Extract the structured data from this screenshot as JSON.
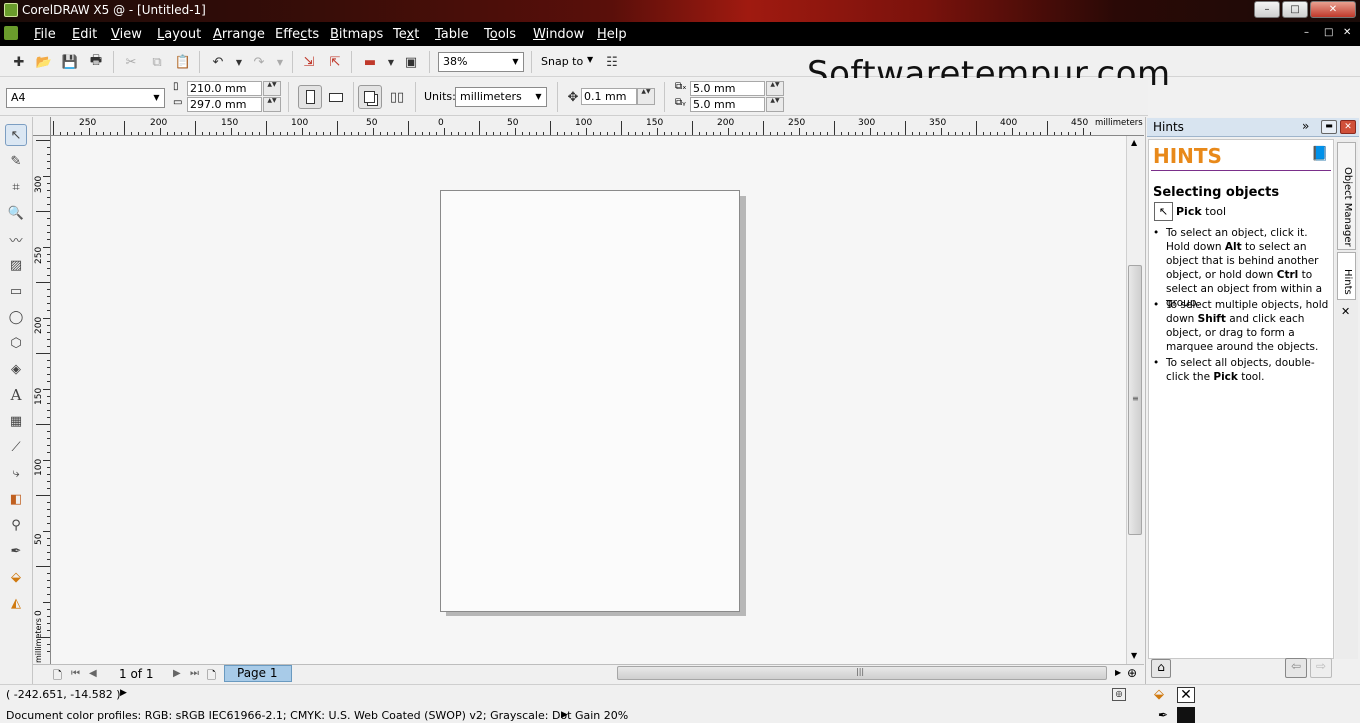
{
  "window": {
    "title": "CorelDRAW X5 @ - [Untitled-1]",
    "min_label": "–",
    "max_label": "□",
    "close_label": "✕"
  },
  "menubar": {
    "items": [
      {
        "label_u": "F",
        "label_rest": "ile"
      },
      {
        "label_u": "E",
        "label_rest": "dit"
      },
      {
        "label_u": "V",
        "label_rest": "iew"
      },
      {
        "label_u": "L",
        "label_rest": "ayout"
      },
      {
        "label_u": "A",
        "label_rest": "rrange"
      },
      {
        "label_pre": "Effe",
        "label_u": "c",
        "label_rest": "ts"
      },
      {
        "label_u": "B",
        "label_rest": "itmaps"
      },
      {
        "label_pre": "Te",
        "label_u": "x",
        "label_rest": "t"
      },
      {
        "label_u": "T",
        "label_rest": "able"
      },
      {
        "label_pre": "T",
        "label_u": "o",
        "label_rest": "ols"
      },
      {
        "label_u": "W",
        "label_rest": "indow"
      },
      {
        "label_u": "H",
        "label_rest": "elp"
      }
    ],
    "doc_controls": [
      "–",
      "□",
      "✕"
    ]
  },
  "standard_toolbar": {
    "zoom_level": "38%",
    "snap_to_label": "Snap to"
  },
  "property_bar": {
    "page_size": "A4",
    "width": "210.0 mm",
    "height": "297.0 mm",
    "units_label": "Units:",
    "units_value": "millimeters",
    "nudge": "0.1 mm",
    "dup_x": "5.0 mm",
    "dup_y": "5.0 mm"
  },
  "watermark": "Softwaretempur.com",
  "rulers": {
    "unit": "millimeters",
    "h_labels": [
      "250",
      "200",
      "150",
      "100",
      "50",
      "0",
      "50",
      "100",
      "150",
      "200",
      "250",
      "300",
      "350",
      "400",
      "450"
    ],
    "v_labels": [
      "300",
      "250",
      "200",
      "150",
      "100",
      "50",
      "0"
    ],
    "v_unit": "millimeters"
  },
  "page_nav": {
    "count": "1 of 1",
    "tab": "Page 1"
  },
  "status": {
    "coords": "( -242.651, -14.582 )",
    "profiles": "Document color profiles: RGB: sRGB IEC61966-2.1; CMYK: U.S. Web Coated (SWOP) v2; Grayscale: Dot Gain 20%"
  },
  "docker": {
    "header": "Hints",
    "title": "HINTS",
    "section": "Selecting objects",
    "tool_bold": "Pick",
    "tool_rest": " tool",
    "bullets": [
      {
        "parts": [
          "To select an object, click it. Hold down ",
          "Alt",
          " to select an object that is behind another object, or hold down ",
          "Ctrl",
          " to select an object from within a group."
        ]
      },
      {
        "parts": [
          "To select multiple objects, hold down ",
          "Shift",
          " and click each object, or drag to form a marquee around the objects."
        ]
      },
      {
        "parts": [
          "To select all objects, double-click the ",
          "Pick",
          " tool."
        ]
      }
    ],
    "tabs": [
      "Object Manager",
      "Hints"
    ]
  },
  "colors": {
    "accent": "#e8891a",
    "page_tab": "#a8cbe8",
    "docker_head": "#d8e4f0"
  }
}
